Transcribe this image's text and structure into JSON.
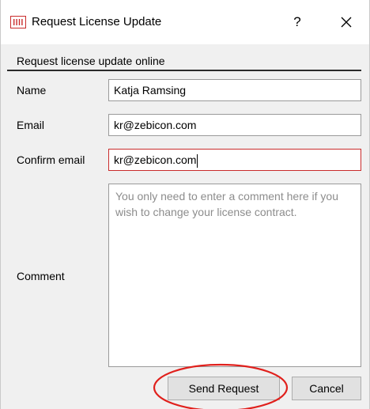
{
  "window": {
    "title": "Request License Update",
    "help_label": "?",
    "close_icon": "close-icon",
    "app_icon": "license-app-icon"
  },
  "form": {
    "section_label": "Request license update online",
    "name": {
      "label": "Name",
      "value": "Katja Ramsing"
    },
    "email": {
      "label": "Email",
      "value": "kr@zebicon.com"
    },
    "confirm_email": {
      "label": "Confirm email",
      "value": "kr@zebicon.com"
    },
    "comment": {
      "label": "Comment",
      "placeholder": "You only need to enter a comment here if you wish to change your license contract."
    }
  },
  "buttons": {
    "send_label": "Send Request",
    "cancel_label": "Cancel"
  },
  "colors": {
    "accent_red": "#c92b2b",
    "highlight_ellipse": "#e0201c"
  }
}
